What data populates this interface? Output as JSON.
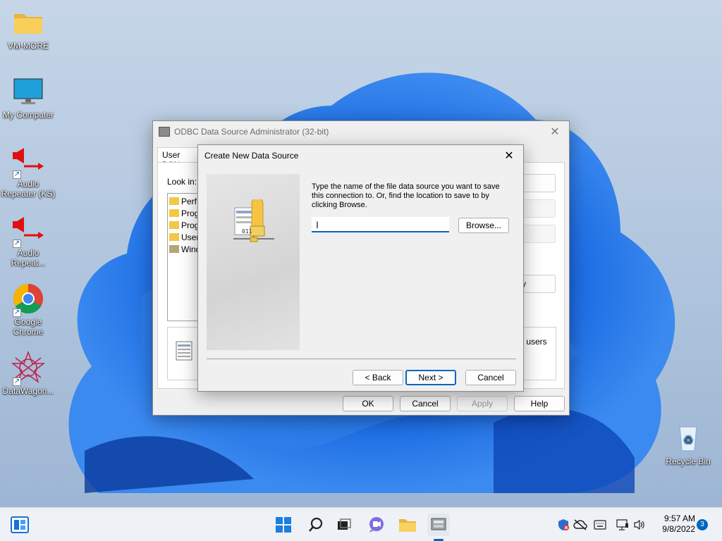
{
  "desktop": {
    "icons": [
      {
        "label": "VM-MORE"
      },
      {
        "label": "My Computer"
      },
      {
        "label": "Audio Repeater (KS)"
      },
      {
        "label": "Audio Repeat..."
      },
      {
        "label": "Google Chrome"
      },
      {
        "label": "DataWagon..."
      },
      {
        "label": "Recycle Bin"
      }
    ]
  },
  "odbc_window": {
    "title": "ODBC Data Source Administrator (32-bit)",
    "tab_user_dsn": "User DSN",
    "look_in_label": "Look in:",
    "folders": [
      "PerfL",
      "Progr",
      "Progr",
      "Users",
      "Wind"
    ],
    "side_text": "y users",
    "side_button_partial": "y",
    "buttons": {
      "ok": "OK",
      "cancel": "Cancel",
      "apply": "Apply",
      "help": "Help"
    }
  },
  "dialog": {
    "title": "Create New Data Source",
    "instruction": "Type the name of the file data source you want to save this connection to.  Or, find the location to save to by clicking Browse.",
    "input_value": "",
    "browse_label": "Browse...",
    "back_label": "< Back",
    "next_label": "Next >",
    "cancel_label": "Cancel",
    "graphic_text": "011"
  },
  "taskbar": {
    "time": "9:57 AM",
    "date": "9/8/2022",
    "notification_count": "3"
  },
  "colors": {
    "accent": "#0067c0",
    "wallpaper_blue": "#1665d8",
    "taskbar_bg": "#eef1f6"
  }
}
